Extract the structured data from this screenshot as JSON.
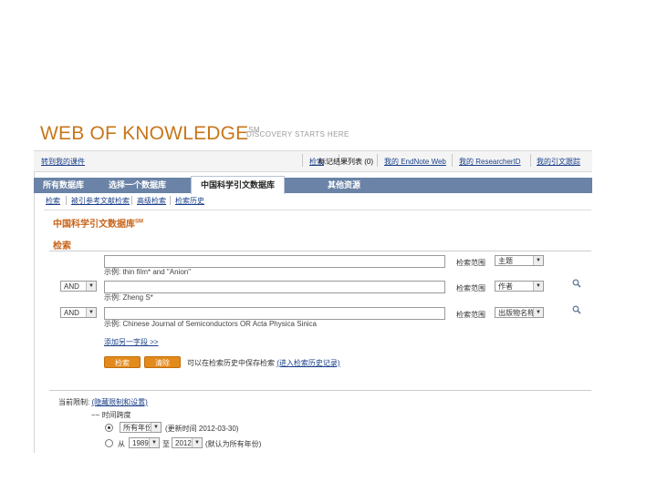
{
  "logo": {
    "text": "WEB OF KNOWLEDGE",
    "mark": "SM",
    "tagline": "DISCOVERY STARTS HERE"
  },
  "topbar": {
    "left_link": "转到我的课件",
    "links": [
      "检索",
      "标记结果列表 (0)",
      "我的 EndNote Web",
      "我的 ResearcherID",
      "我的引文跟踪"
    ]
  },
  "tabs": [
    "所有数据库",
    "选择一个数据库",
    "中国科学引文数据库",
    "其他资源"
  ],
  "subnav": [
    "检索",
    "被引参考文献检索",
    "高级检索",
    "检索历史"
  ],
  "db_title": "中国科学引文数据库",
  "db_title_mark": "SM",
  "section_title": "检索",
  "rows": [
    {
      "operator": "",
      "example": "示例: thin film* and \"Anion\"",
      "range_label": "检索范围",
      "range_value": "主题"
    },
    {
      "operator": "AND",
      "example": "示例: Zheng S*",
      "range_label": "检索范围",
      "range_value": "作者"
    },
    {
      "operator": "AND",
      "example": "示例: Chinese Journal of Semiconductors OR Acta Physica Sinica",
      "range_label": "检索范围",
      "range_value": "出版物名称"
    }
  ],
  "add_row": "添加另一字段 >>",
  "buttons": {
    "search": "检索",
    "clear": "清除"
  },
  "hint": {
    "text": "可以在检索历史中保存检索",
    "link": "(进入检索历史记录)"
  },
  "limits": {
    "text": "当前限制:",
    "link": "(隐藏限制和设置)"
  },
  "timespan": {
    "label": "时间跨度"
  },
  "time_options": [
    {
      "select": "所有年份",
      "note": "(更新时间 2012-03-30)",
      "selected": true
    },
    {
      "prefix": "从",
      "from": "1989",
      "to_label": "至",
      "to": "2012",
      "note": "(默认为所有年份)",
      "selected": false
    }
  ],
  "colors": {
    "brand_orange": "#c8761a",
    "tab_blue": "#6a83a6",
    "link_blue": "#1a3f8a"
  }
}
